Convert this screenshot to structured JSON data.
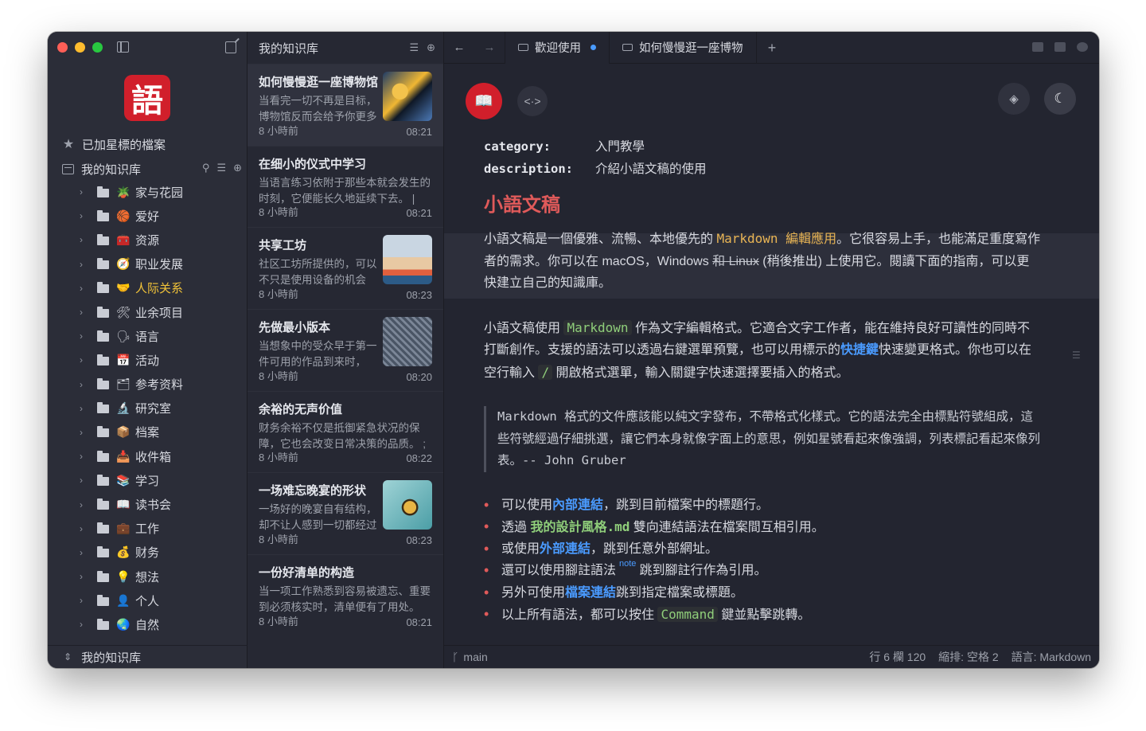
{
  "sidebar": {
    "starred_label": "已加星標的檔案",
    "vault_label": "我的知识库",
    "footer_label": "我的知识库",
    "logo_char": "語",
    "items": [
      {
        "emoji": "🪴",
        "label": "家与花园"
      },
      {
        "emoji": "🏀",
        "label": "爱好"
      },
      {
        "emoji": "🧰",
        "label": "资源"
      },
      {
        "emoji": "🧭",
        "label": "职业发展"
      },
      {
        "emoji": "🤝",
        "label": "人际关系",
        "active": true
      },
      {
        "emoji": "🛠",
        "label": "业余项目"
      },
      {
        "emoji": "🗣",
        "label": "语言"
      },
      {
        "emoji": "📅",
        "label": "活动"
      },
      {
        "emoji": "🗂",
        "label": "参考资料"
      },
      {
        "emoji": "🔬",
        "label": "研究室"
      },
      {
        "emoji": "📦",
        "label": "档案"
      },
      {
        "emoji": "📥",
        "label": "收件箱"
      },
      {
        "emoji": "📚",
        "label": "学习"
      },
      {
        "emoji": "📖",
        "label": "读书会"
      },
      {
        "emoji": "💼",
        "label": "工作"
      },
      {
        "emoji": "💰",
        "label": "财务"
      },
      {
        "emoji": "💡",
        "label": "想法"
      },
      {
        "emoji": "👤",
        "label": "个人"
      },
      {
        "emoji": "🌏",
        "label": "自然"
      }
    ]
  },
  "notelist": {
    "title": "我的知识库",
    "notes": [
      {
        "title": "如何慢慢逛一座博物馆",
        "excerpt": "当看完一切不再是目标，博物馆反而会给予你更多",
        "meta": "8 小時前",
        "time": "08:21",
        "thumb": 1
      },
      {
        "title": "在细小的仪式中学习",
        "excerpt": "当语言练习依附于那些本就会发生的时刻，它便能长久地延续下去。 |",
        "meta": "8 小時前",
        "time": "08:21"
      },
      {
        "title": "共享工坊",
        "excerpt": "社区工坊所提供的，可以不只是使用设备的机会",
        "meta": "8 小時前",
        "time": "08:23",
        "thumb": 2
      },
      {
        "title": "先做最小版本",
        "excerpt": "当想象中的受众早于第一件可用的作品到来时，",
        "meta": "8 小時前",
        "time": "08:20",
        "thumb": 3
      },
      {
        "title": "余裕的无声价值",
        "excerpt": "财务余裕不仅是抵御紧急状况的保障，它也会改变日常决策的品质。 ;",
        "meta": "8 小時前",
        "time": "08:22"
      },
      {
        "title": "一场难忘晚宴的形状",
        "excerpt": "一场好的晚宴自有结构，却不让人感到一切都经过",
        "meta": "8 小時前",
        "time": "08:23",
        "thumb": 4
      },
      {
        "title": "一份好清单的构造",
        "excerpt": "当一项工作熟悉到容易被遗忘、重要到必须核实时，清单便有了用处。",
        "meta": "8 小時前",
        "time": "08:21"
      }
    ]
  },
  "tabs": [
    {
      "label": "歡迎使用",
      "modified": true
    },
    {
      "label": "如何慢慢逛一座博物"
    }
  ],
  "doc": {
    "fm_category_key": "category:",
    "fm_category_val": "入門教學",
    "fm_desc_key": "description:",
    "fm_desc_val": "介紹小語文稿的使用",
    "heading": "小語文稿",
    "p1_a": "小語文稿是一個優雅、流暢、本地優先的 ",
    "p1_code": "Markdown 編輯應用",
    "p1_b": "。它很容易上手，也能滿足重度寫作者的需求。你可以在 macOS，Windows ",
    "p1_strike": "和 Linux",
    "p1_c": " (稍後推出) 上使用它。閱讀下面的指南，可以更快建立自己的知識庫。",
    "p2_a": "小語文稿使用 ",
    "p2_code": "Markdown",
    "p2_b": " 作為文字編輯格式。它適合文字工作者，能在維持良好可讀性的同時不打斷創作。支援的語法可以透過右鍵選單預覽，也可以用標示的",
    "p2_link": "快捷鍵",
    "p2_c": "快速變更格式。你也可以在空行輸入 ",
    "p2_code2": "/",
    "p2_d": " 開啟格式選單，輸入關鍵字快速選擇要插入的格式。",
    "quote": "Markdown 格式的文件應該能以純文字發布，不帶格式化樣式。它的語法完全由標點符號組成，這些符號經過仔細挑選，讓它們本身就像字面上的意思，例如星號看起來像強調，列表標記看起來像列表。-- John Gruber",
    "b1_a": "可以使用",
    "b1_link": "內部連結",
    "b1_b": "，跳到目前檔案中的標題行。",
    "b2_a": "透過 ",
    "b2_link": "我的設計風格.md",
    "b2_b": " 雙向連結語法在檔案間互相引用。",
    "b3_a": "或使用",
    "b3_link": "外部連結",
    "b3_b": "，跳到任意外部網址。",
    "b4_a": "還可以使用腳註語法",
    "b4_sup": "note",
    "b4_b": "跳到腳註行作為引用。",
    "b5_a": "另外可使用",
    "b5_link": "檔案連結",
    "b5_b": "跳到指定檔案或標題。",
    "b6_a": "以上所有語法，都可以按住 ",
    "b6_code": "Command",
    "b6_b": " 鍵並點擊跳轉。"
  },
  "status": {
    "branch": "main",
    "position": "行 6 欄 120",
    "indent": "縮排: 空格 2",
    "language": "語言: Markdown"
  },
  "colors": {
    "accent_red": "#d11f2b",
    "link_blue": "#4a9bff",
    "code_green": "#8fce7a",
    "code_yellow": "#e8b454",
    "active_folder": "#f0c239"
  }
}
